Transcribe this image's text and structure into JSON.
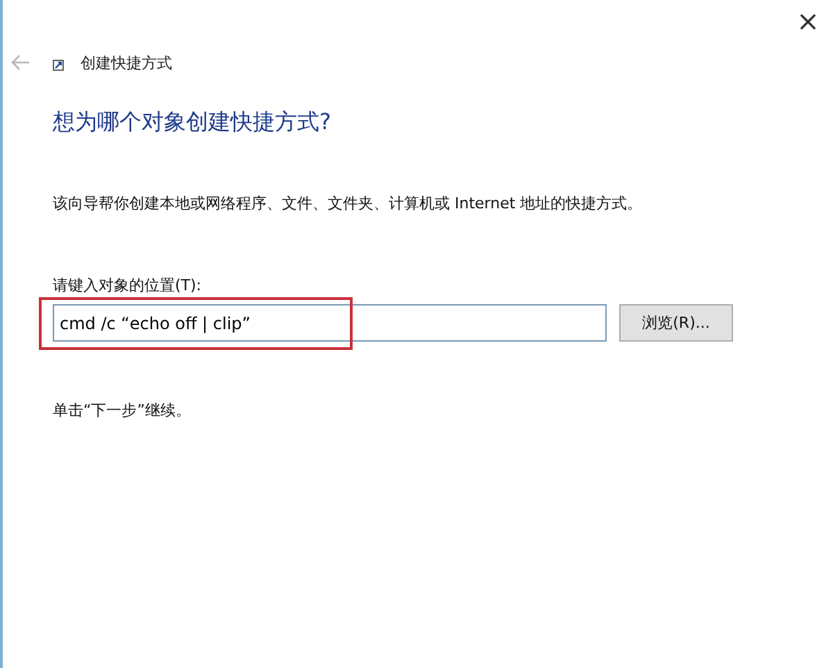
{
  "window": {
    "title": "创建快捷方式",
    "close": "×"
  },
  "heading": "想为哪个对象创建快捷方式?",
  "description": "该向导帮你创建本地或网络程序、文件、文件夹、计算机或 Internet 地址的快捷方式。",
  "location": {
    "label": "请键入对象的位置(T):",
    "value": "cmd /c “echo off | clip”",
    "highlighted": true
  },
  "browse_button": "浏览(R)...",
  "footer": "单击“下一步”继续。"
}
